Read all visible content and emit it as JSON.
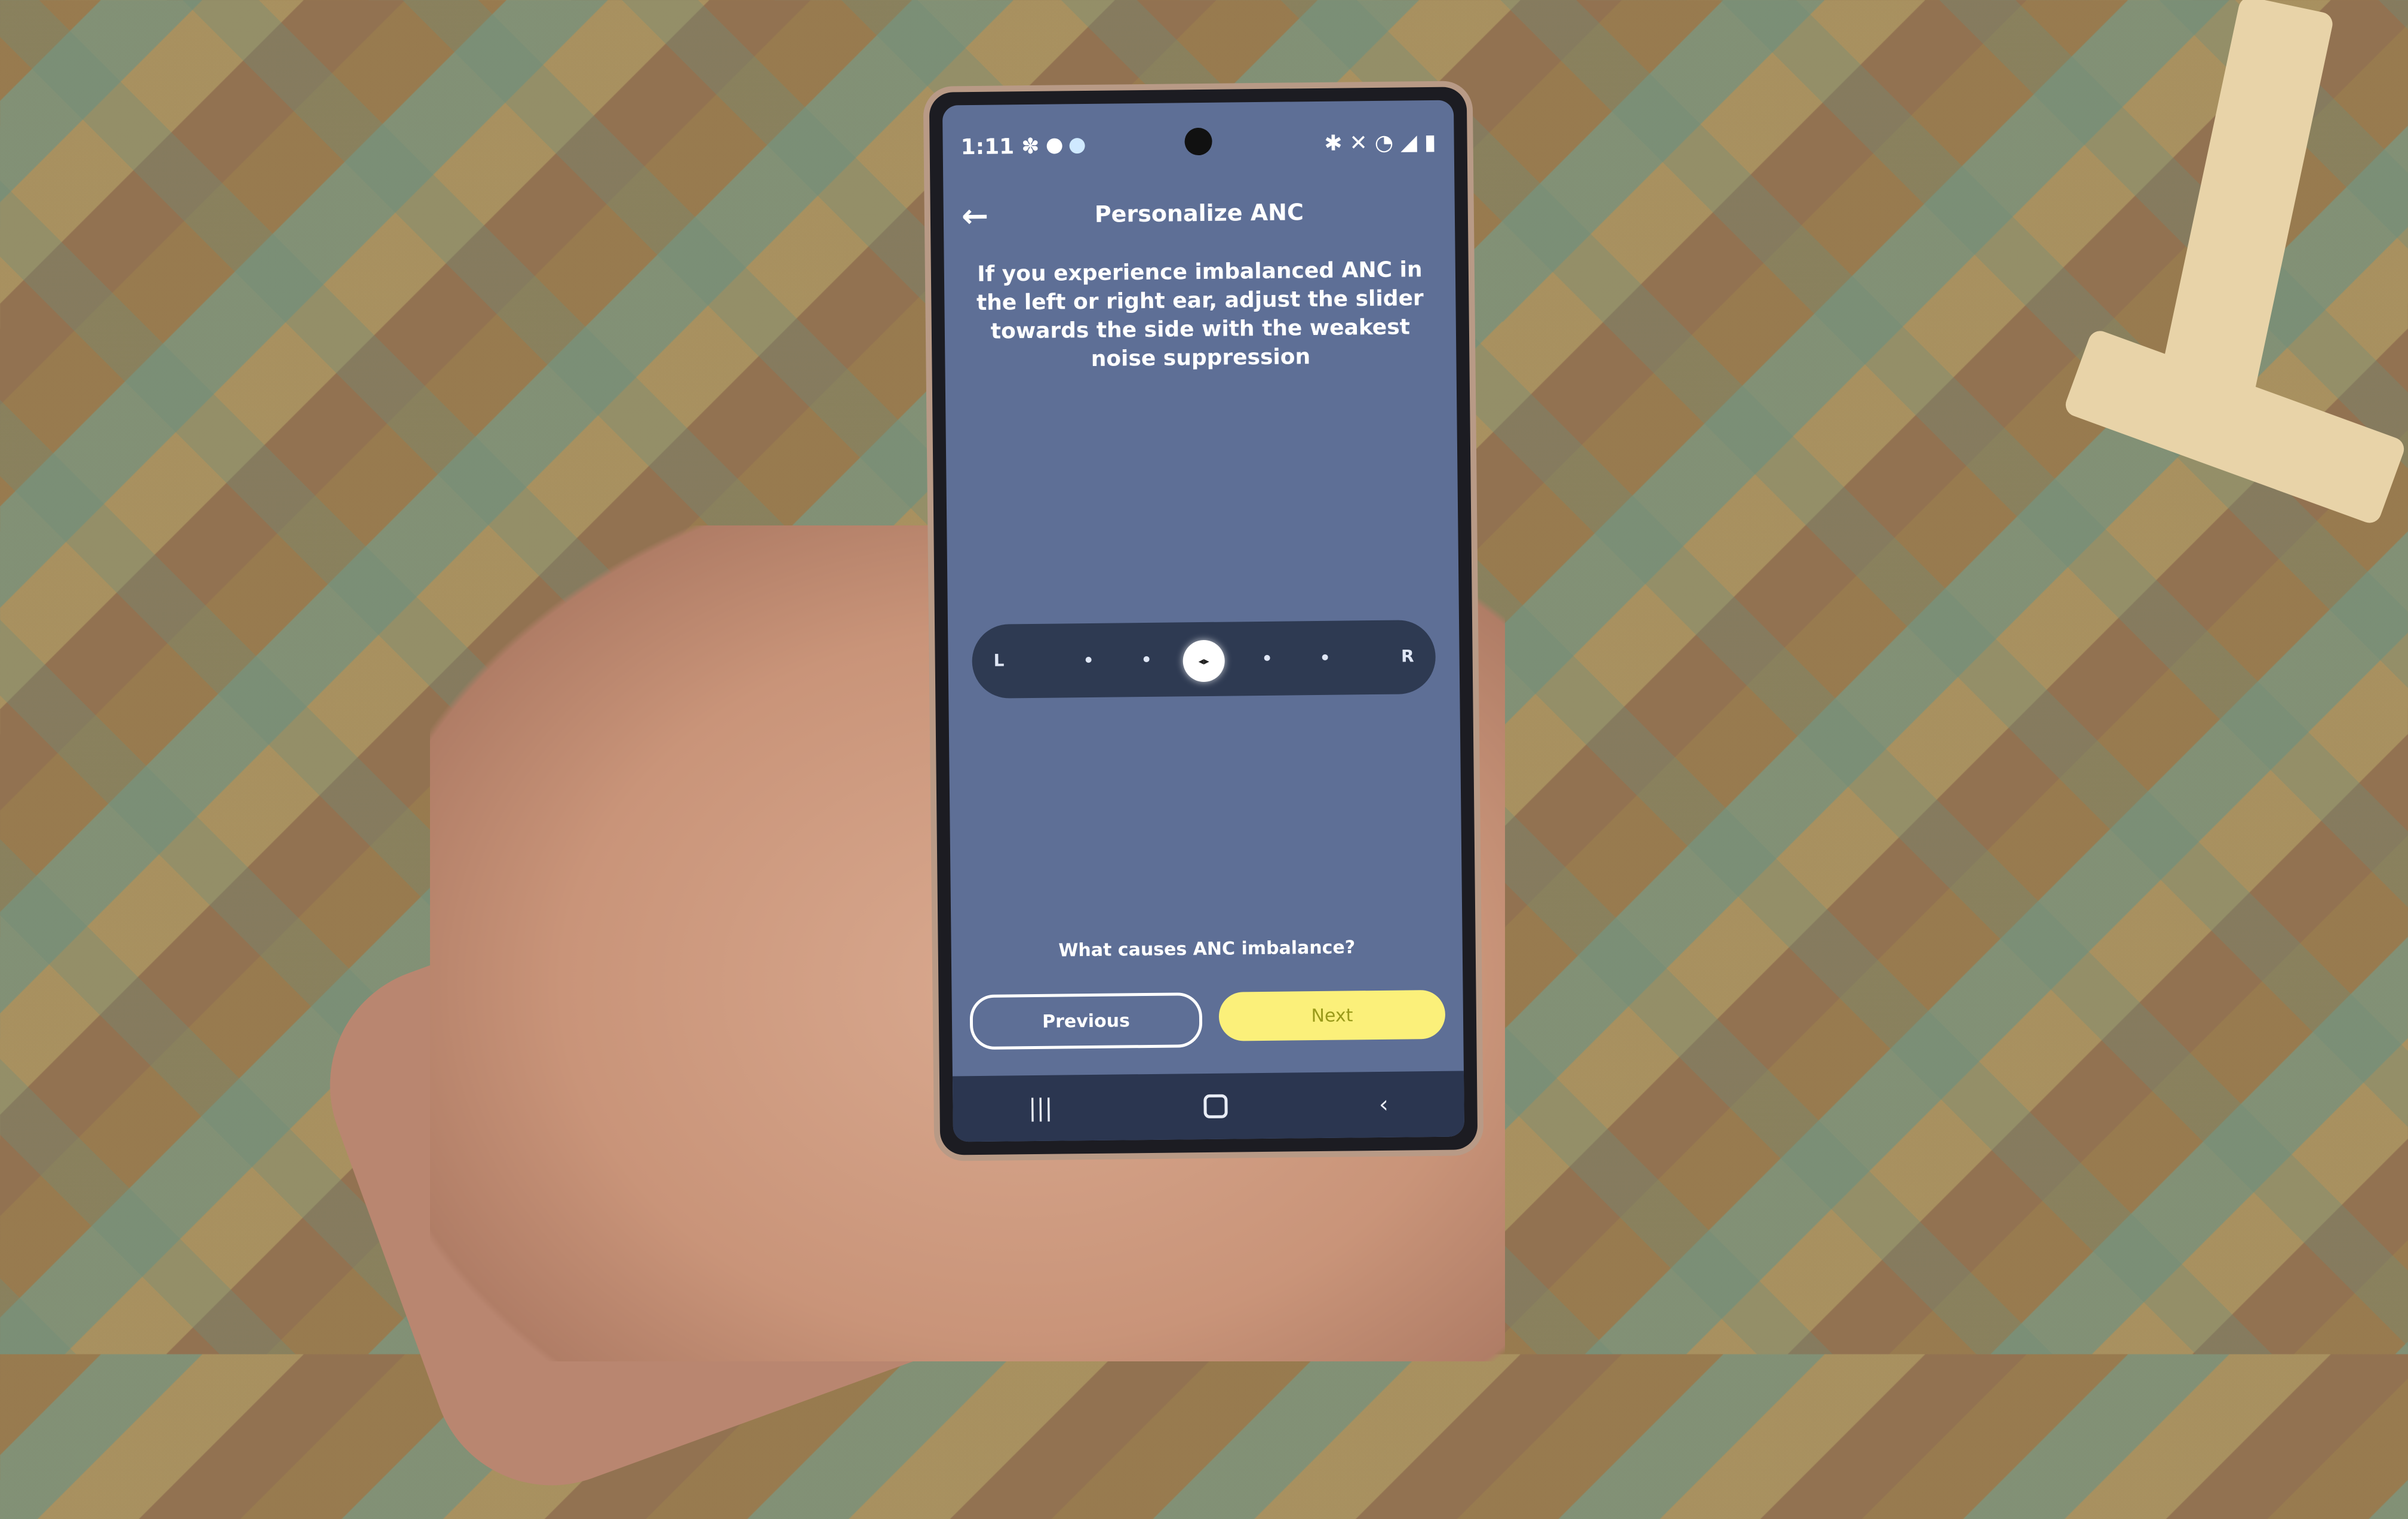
{
  "status_bar": {
    "time": "1:11",
    "left_icons": [
      "pinwheel-icon",
      "dot-icon",
      "dot-icon"
    ],
    "right_icons": [
      "bluetooth-icon",
      "mute-icon",
      "wifi-icon",
      "signal-icon",
      "battery-icon"
    ]
  },
  "app_bar": {
    "back_icon": "←",
    "title": "Personalize ANC"
  },
  "instructions": "If you experience imbalanced ANC in the left or right ear, adjust the slider towards the side with the weakest noise suppression",
  "slider": {
    "left_label": "L",
    "right_label": "R",
    "positions": 7,
    "value_index": 3,
    "thumb_glyph": "◂▸"
  },
  "help_link": "What causes ANC imbalance?",
  "buttons": {
    "previous": "Previous",
    "next": "Next"
  },
  "colors": {
    "screen_bg": "#5e6f96",
    "slider_track": "#2e3a52",
    "next_button": "#fbf07a"
  },
  "nav_bar": {
    "recents": "|||",
    "back": "‹"
  }
}
